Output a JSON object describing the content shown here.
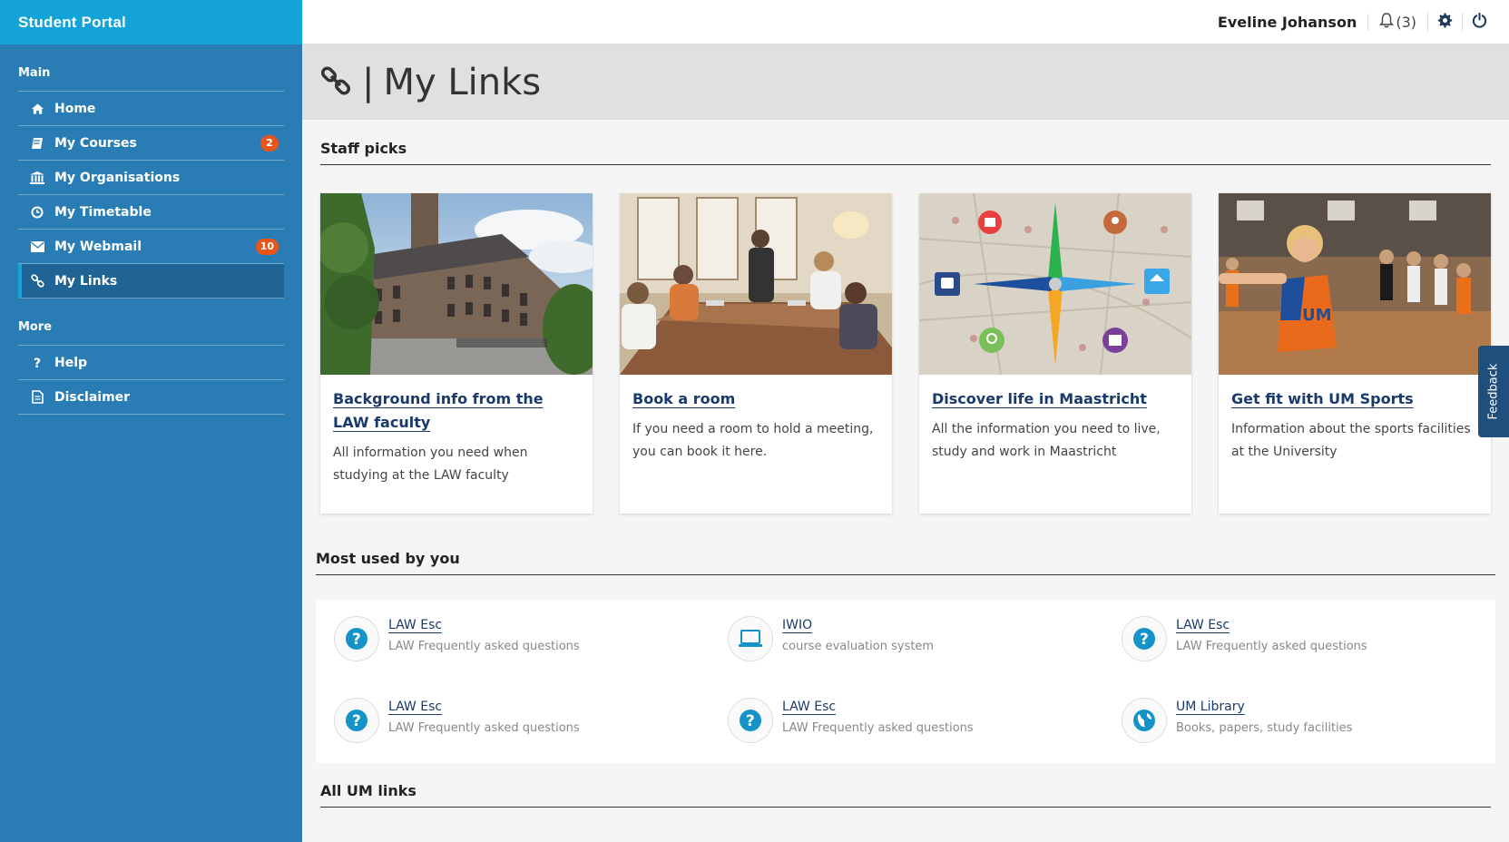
{
  "sidebar": {
    "brand": "Student Portal",
    "main_title": "Main",
    "main_items": [
      {
        "label": "Home",
        "icon": "home-icon"
      },
      {
        "label": "My Courses",
        "icon": "book-icon",
        "badge": "2"
      },
      {
        "label": "My Organisations",
        "icon": "building-icon"
      },
      {
        "label": "My Timetable",
        "icon": "clock-icon"
      },
      {
        "label": "My Webmail",
        "icon": "mail-icon",
        "badge": "10"
      },
      {
        "label": "My Links",
        "icon": "link-icon",
        "active": true
      }
    ],
    "more_title": "More",
    "more_items": [
      {
        "label": "Help",
        "icon": "question-icon"
      },
      {
        "label": "Disclaimer",
        "icon": "document-icon"
      }
    ]
  },
  "topbar": {
    "user_name": "Eveline Johanson",
    "notifications": "(3)"
  },
  "header": {
    "separator": "|",
    "title": "My Links"
  },
  "staff_picks": {
    "heading": "Staff picks",
    "cards": [
      {
        "title": "Background info from the LAW faculty",
        "desc": "All information you need when studying at the LAW faculty"
      },
      {
        "title": "Book a room",
        "desc": "If you need a room to hold a meeting, you can book it here."
      },
      {
        "title": "Discover life in Maastricht",
        "desc": "All the information you need to live, study and work in Maastricht"
      },
      {
        "title": "Get fit with UM Sports",
        "desc": "Information about the sports facilities at the University"
      }
    ]
  },
  "most_used": {
    "heading": "Most used by you",
    "items": [
      {
        "title": "LAW Esc",
        "sub": "LAW Frequently asked questions",
        "icon": "question-circle-icon"
      },
      {
        "title": "IWIO",
        "sub": "course evaluation system",
        "icon": "laptop-icon"
      },
      {
        "title": "LAW Esc",
        "sub": "LAW Frequently asked questions",
        "icon": "question-circle-icon"
      },
      {
        "title": "LAW Esc",
        "sub": "LAW Frequently asked questions",
        "icon": "question-circle-icon"
      },
      {
        "title": "LAW Esc",
        "sub": "LAW Frequently asked questions",
        "icon": "question-circle-icon"
      },
      {
        "title": "UM Library",
        "sub": "Books, papers, study facilities",
        "icon": "globe-icon"
      }
    ]
  },
  "all_links": {
    "heading": "All UM links"
  },
  "feedback": {
    "label": "Feedback"
  },
  "colors": {
    "sidebar": "#2a7db4",
    "brand_bar": "#13a3d9",
    "badge": "#e8541a",
    "link": "#1a3a6b",
    "icon_accent": "#1593c8"
  }
}
